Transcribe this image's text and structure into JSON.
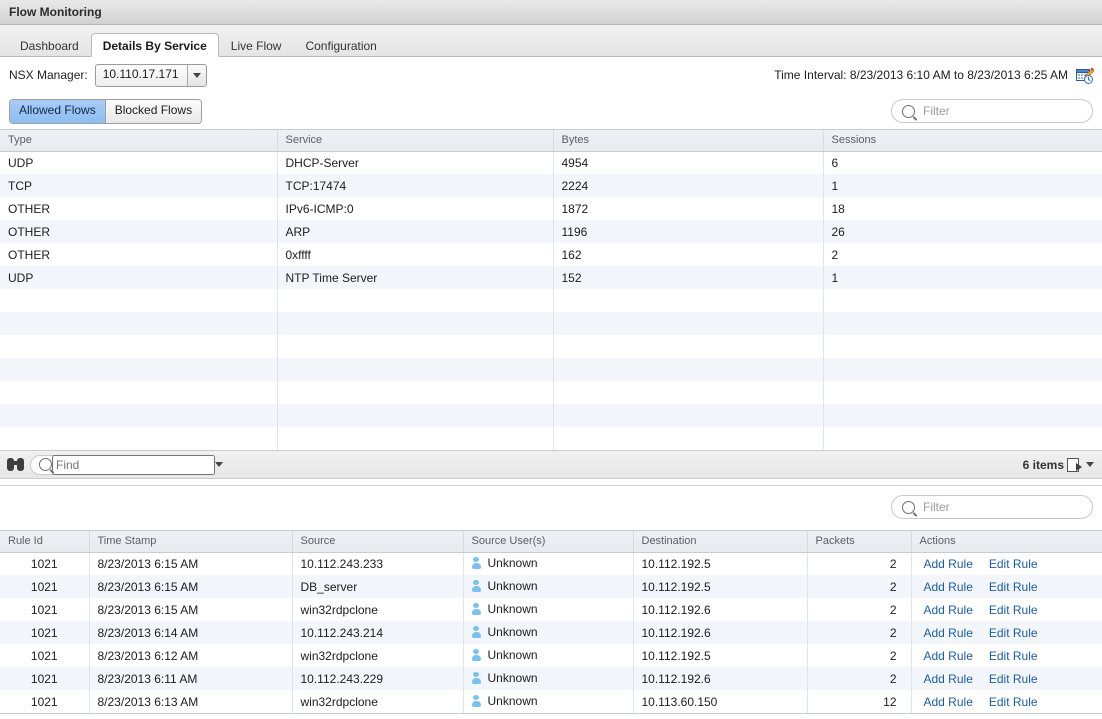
{
  "window": {
    "title": "Flow Monitoring"
  },
  "tabs": [
    {
      "label": "Dashboard",
      "active": false
    },
    {
      "label": "Details By Service",
      "active": true
    },
    {
      "label": "Live Flow",
      "active": false
    },
    {
      "label": "Configuration",
      "active": false
    }
  ],
  "manager_row": {
    "label": "NSX Manager:",
    "selected": "10.110.17.171",
    "time_interval": "Time Interval: 8/23/2013 6:10 AM to 8/23/2013 6:25 AM",
    "calendar_icon": "calendar-edit-icon"
  },
  "flow_toggle": {
    "allowed_label": "Allowed Flows",
    "blocked_label": "Blocked Flows",
    "selected": "Allowed Flows",
    "selected_color": "#8dbdf2"
  },
  "top_filter": {
    "placeholder": "Filter",
    "value": "",
    "icon": "search-icon"
  },
  "services_table": {
    "columns": [
      "Type",
      "Service",
      "Bytes",
      "Sessions"
    ],
    "rows": [
      {
        "type": "UDP",
        "service": "DHCP-Server",
        "bytes": "4954",
        "sessions": "6"
      },
      {
        "type": "TCP",
        "service": "TCP:17474",
        "bytes": "2224",
        "sessions": "1"
      },
      {
        "type": "OTHER",
        "service": "IPv6-ICMP:0",
        "bytes": "1872",
        "sessions": "18"
      },
      {
        "type": "OTHER",
        "service": "ARP",
        "bytes": "1196",
        "sessions": "26"
      },
      {
        "type": "OTHER",
        "service": "0xffff",
        "bytes": "162",
        "sessions": "2"
      },
      {
        "type": "UDP",
        "service": "NTP Time Server",
        "bytes": "152",
        "sessions": "1"
      }
    ],
    "empty_row_count": 7
  },
  "services_footer": {
    "find_placeholder": "Find",
    "find_value": "",
    "items_count": "6 items",
    "binoculars_icon": "binoculars-icon",
    "export_icon": "export-icon"
  },
  "bottom_filter": {
    "placeholder": "Filter",
    "value": "",
    "icon": "search-icon"
  },
  "flows_table": {
    "columns": [
      "Rule Id",
      "Time Stamp",
      "Source",
      "Source User(s)",
      "Destination",
      "Packets",
      "Actions"
    ],
    "add_rule_label": "Add Rule",
    "edit_rule_label": "Edit Rule",
    "rows": [
      {
        "rule_id": "1021",
        "time_stamp": "8/23/2013 6:15 AM",
        "source": "10.112.243.233",
        "source_user": "Unknown",
        "destination": "10.112.192.5",
        "packets": "2"
      },
      {
        "rule_id": "1021",
        "time_stamp": "8/23/2013 6:15 AM",
        "source": "DB_server",
        "source_user": "Unknown",
        "destination": "10.112.192.5",
        "packets": "2"
      },
      {
        "rule_id": "1021",
        "time_stamp": "8/23/2013 6:15 AM",
        "source": "win32rdpclone",
        "source_user": "Unknown",
        "destination": "10.112.192.6",
        "packets": "2"
      },
      {
        "rule_id": "1021",
        "time_stamp": "8/23/2013 6:14 AM",
        "source": "10.112.243.214",
        "source_user": "Unknown",
        "destination": "10.112.192.6",
        "packets": "2"
      },
      {
        "rule_id": "1021",
        "time_stamp": "8/23/2013 6:12 AM",
        "source": "win32rdpclone",
        "source_user": "Unknown",
        "destination": "10.112.192.5",
        "packets": "2"
      },
      {
        "rule_id": "1021",
        "time_stamp": "8/23/2013 6:11 AM",
        "source": "10.112.243.229",
        "source_user": "Unknown",
        "destination": "10.112.192.6",
        "packets": "2"
      },
      {
        "rule_id": "1021",
        "time_stamp": "8/23/2013 6:13 AM",
        "source": "win32rdpclone",
        "source_user": "Unknown",
        "destination": "10.113.60.150",
        "packets": "12"
      }
    ]
  }
}
